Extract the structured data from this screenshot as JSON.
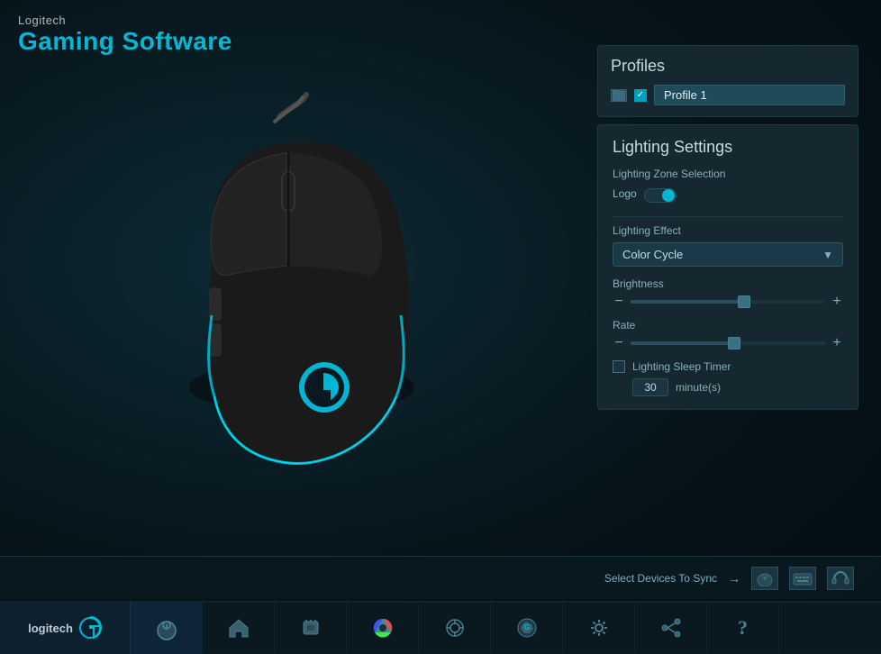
{
  "app": {
    "brand": "Logitech",
    "title": "Gaming Software"
  },
  "header": {
    "brand": "Logitech",
    "title": "Gaming Software"
  },
  "profiles": {
    "title": "Profiles",
    "active_profile": "Profile 1",
    "checkbox_checked": "✓"
  },
  "lighting": {
    "title": "Lighting Settings",
    "zone_section_label": "Lighting Zone Selection",
    "zone_label": "Logo",
    "toggle_state": "on",
    "effect_label": "Lighting Effect",
    "effect_value": "Color Cycle",
    "brightness_label": "Brightness",
    "rate_label": "Rate",
    "sleep_label": "Lighting Sleep Timer",
    "sleep_value": "30",
    "sleep_unit": "minute(s)"
  },
  "sync_bar": {
    "label": "Select Devices To Sync",
    "arrow": "→"
  },
  "nav": {
    "brand": "logitech",
    "items": [
      {
        "icon": "🖱",
        "name": "mouse"
      },
      {
        "icon": "🏠",
        "name": "home"
      },
      {
        "icon": "⬡",
        "name": "device"
      },
      {
        "icon": "⬤",
        "name": "color"
      },
      {
        "icon": "⊕",
        "name": "target"
      },
      {
        "icon": "◈",
        "name": "game"
      },
      {
        "icon": "⚙",
        "name": "settings"
      },
      {
        "icon": "⇄",
        "name": "share"
      },
      {
        "icon": "?",
        "name": "help"
      }
    ]
  }
}
